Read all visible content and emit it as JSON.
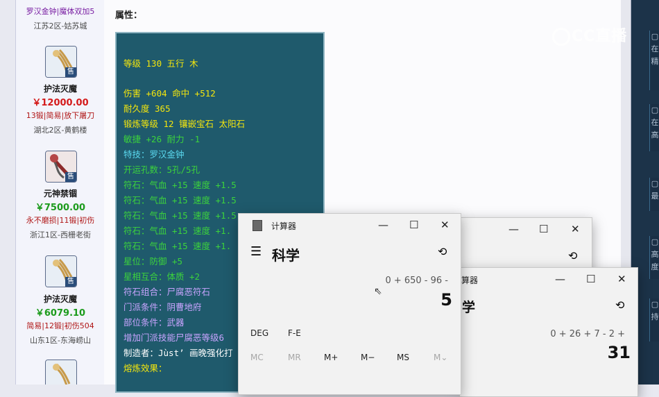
{
  "colors": {
    "price_red": "#d41a1a",
    "price_green": "#1c9b1c",
    "attr_bg": "#1f5a6c",
    "yellow": "#f4e60d",
    "green": "#3cd33c",
    "cyan": "#5ad8ee",
    "purple": "#c9a4ff"
  },
  "listings": [
    {
      "tags_top": "罗汉金钟|魔体双加5",
      "server": "江苏2区-姑苏城"
    },
    {
      "name": "护法灭魔",
      "price": "￥12000.00",
      "tags": "13锻|简易|放下屠刀",
      "server": "湖北2区-黄鹤楼",
      "sale": "售",
      "icon": "weapon-claw-icon"
    },
    {
      "name": "元神禁锢",
      "price": "￥7500.00",
      "tags": "永不磨损|11锻|初伤",
      "server": "浙江1区-西栅老街",
      "sale": "售",
      "icon": "weapon-sword-icon"
    },
    {
      "name": "护法灭魔",
      "price": "￥6079.10",
      "tags": "简易|12锻|初伤504",
      "server": "山东1区-东海崂山",
      "sale": "售",
      "icon": "weapon-claw-icon"
    }
  ],
  "attributes": {
    "heading": "属性：",
    "lines": [
      {
        "text": "等级 130 五行 木",
        "color": "yellow"
      },
      {
        "text": "伤害 +604 命中 +512",
        "color": "yellow"
      },
      {
        "text": "耐久度 365",
        "color": "yellow"
      },
      {
        "text": "锻炼等级 12 镶嵌宝石 太阳石",
        "color": "yellow"
      },
      {
        "text": "敏捷 +26 耐力 -1",
        "color": "green"
      },
      {
        "text": "特技：罗汉金钟",
        "color": "cyan"
      },
      {
        "text": "开运孔数：5孔/5孔",
        "color": "green"
      },
      {
        "text": "符石：气血 +15 速度 +1.5",
        "color": "green"
      },
      {
        "text": "符石：气血 +15 速度 +1.5",
        "color": "green"
      },
      {
        "text": "符石：气血 +15 速度 +1.5",
        "color": "green"
      },
      {
        "text": "符石：气血 +15 速度 +1.",
        "color": "green"
      },
      {
        "text": "符石：气血 +15 速度 +1.",
        "color": "green"
      },
      {
        "text": "星位：防御 +5",
        "color": "green"
      },
      {
        "text": "星相互合：体质 +2",
        "color": "green"
      },
      {
        "text": "符石组合：尸腐恶符石",
        "color": "purple"
      },
      {
        "text": "门派条件：阴曹地府",
        "color": "purple"
      },
      {
        "text": "部位条件：武器",
        "color": "purple"
      },
      {
        "text": "增加门派技能尸腐恶等级6",
        "color": "purple"
      },
      {
        "text": "制造者：Jùst’ 画晚强化打",
        "color": "white"
      },
      {
        "text": "熔炼效果：",
        "color": "yellow"
      }
    ]
  },
  "watermark": {
    "text": "CC直播"
  },
  "calc_back": {
    "mode": "学",
    "title": "算器",
    "expression": "0 + 26 + 7 - 2 +",
    "result": "31"
  },
  "calc_front": {
    "title": "计算器",
    "mode": "科学",
    "expression": "0 + 650 - 96 -",
    "result": "5",
    "angle_keys": [
      "DEG",
      "F-E"
    ],
    "memory_keys": [
      "MC",
      "MR",
      "M+",
      "M−",
      "MS",
      "M⌄"
    ]
  },
  "window_controls": {
    "min": "—",
    "max": "☐",
    "close": "✕"
  }
}
